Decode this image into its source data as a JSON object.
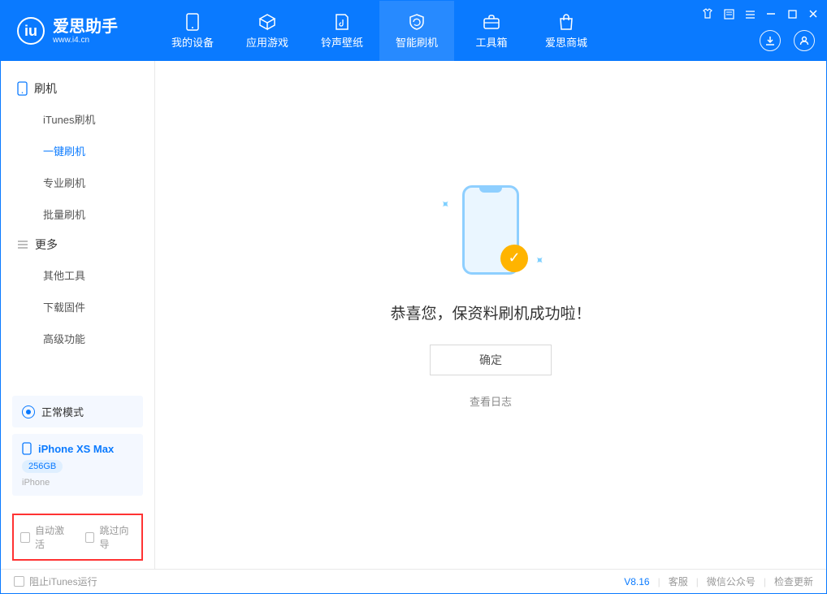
{
  "app": {
    "name": "爱思助手",
    "url": "www.i4.cn"
  },
  "nav": {
    "tabs": [
      {
        "label": "我的设备"
      },
      {
        "label": "应用游戏"
      },
      {
        "label": "铃声壁纸"
      },
      {
        "label": "智能刷机"
      },
      {
        "label": "工具箱"
      },
      {
        "label": "爱思商城"
      }
    ],
    "active_index": 3
  },
  "sidebar": {
    "sections": [
      {
        "title": "刷机",
        "items": [
          "iTunes刷机",
          "一键刷机",
          "专业刷机",
          "批量刷机"
        ],
        "active_index": 1
      },
      {
        "title": "更多",
        "items": [
          "其他工具",
          "下载固件",
          "高级功能"
        ],
        "active_index": -1
      }
    ],
    "mode_label": "正常模式",
    "device": {
      "name": "iPhone XS Max",
      "capacity": "256GB",
      "type": "iPhone"
    },
    "checks": {
      "auto_activate": "自动激活",
      "skip_guide": "跳过向导"
    }
  },
  "main": {
    "success_text": "恭喜您，保资料刷机成功啦！",
    "ok_button": "确定",
    "view_log": "查看日志"
  },
  "footer": {
    "block_itunes": "阻止iTunes运行",
    "version": "V8.16",
    "links": [
      "客服",
      "微信公众号",
      "检查更新"
    ]
  }
}
